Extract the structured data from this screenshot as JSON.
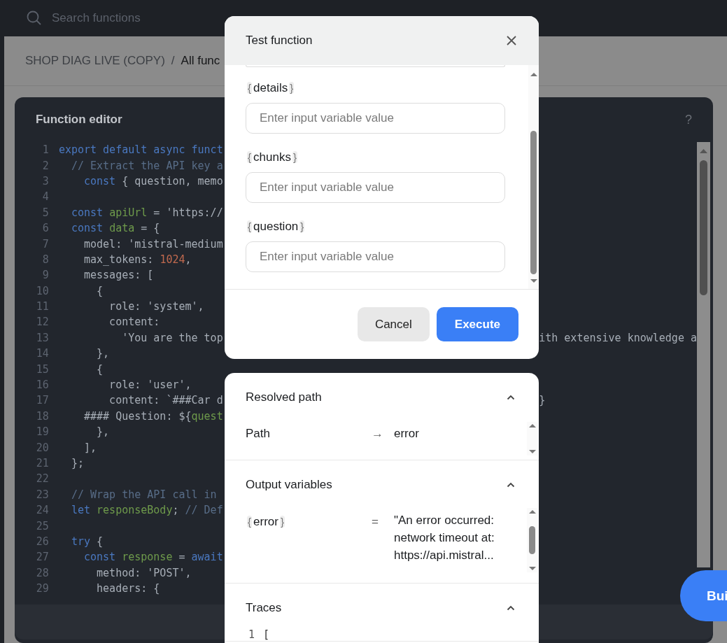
{
  "search": {
    "placeholder": "Search functions"
  },
  "breadcrumb": [
    {
      "label": "SHOP DIAG LIVE (COPY)",
      "current": false
    },
    {
      "label": "All func",
      "current": true
    }
  ],
  "breadcrumb_separator": "/",
  "editor": {
    "title": "Function editor",
    "help": "?",
    "lines": [
      {
        "n": "1",
        "tokens": [
          {
            "kind": "kw",
            "text": "export default async funct"
          }
        ]
      },
      {
        "n": "2",
        "tokens": [
          {
            "kind": "cm",
            "text": "  // Extract the API key a"
          }
        ]
      },
      {
        "n": "3",
        "tokens": [
          {
            "kind": "kw",
            "text": "    const"
          },
          {
            "kind": "p",
            "text": " { question, memo"
          }
        ]
      },
      {
        "n": "4"
      },
      {
        "n": "5",
        "tokens": [
          {
            "kind": "kw",
            "text": "  const "
          },
          {
            "kind": "id",
            "text": "apiUrl"
          },
          {
            "kind": "p",
            "text": " = "
          },
          {
            "kind": "str",
            "text": "'https://"
          }
        ]
      },
      {
        "n": "6",
        "tokens": [
          {
            "kind": "kw",
            "text": "  const "
          },
          {
            "kind": "id",
            "text": "data"
          },
          {
            "kind": "p",
            "text": " = {"
          }
        ]
      },
      {
        "n": "7",
        "tokens": [
          {
            "kind": "p",
            "text": "    model: "
          },
          {
            "kind": "str",
            "text": "'mistral-medium"
          }
        ]
      },
      {
        "n": "8",
        "tokens": [
          {
            "kind": "p",
            "text": "    max_tokens: "
          },
          {
            "kind": "num",
            "text": "1024"
          },
          {
            "kind": "p",
            "text": ","
          }
        ]
      },
      {
        "n": "9",
        "tokens": [
          {
            "kind": "p",
            "text": "    messages: ["
          }
        ]
      },
      {
        "n": "10",
        "tokens": [
          {
            "kind": "p",
            "text": "      {"
          }
        ]
      },
      {
        "n": "11",
        "tokens": [
          {
            "kind": "p",
            "text": "        role: "
          },
          {
            "kind": "str",
            "text": "'system'"
          },
          {
            "kind": "p",
            "text": ","
          }
        ]
      },
      {
        "n": "12",
        "tokens": [
          {
            "kind": "p",
            "text": "        content:"
          }
        ]
      },
      {
        "n": "13",
        "tokens": [
          {
            "kind": "str",
            "text": "          'You are the top"
          }
        ],
        "tail": "ith extensive knowledge a"
      },
      {
        "n": "14",
        "tokens": [
          {
            "kind": "p",
            "text": "      },"
          }
        ]
      },
      {
        "n": "15",
        "tokens": [
          {
            "kind": "p",
            "text": "      {"
          }
        ]
      },
      {
        "n": "16",
        "tokens": [
          {
            "kind": "p",
            "text": "        role: "
          },
          {
            "kind": "str",
            "text": "'user'"
          },
          {
            "kind": "p",
            "text": ","
          }
        ]
      },
      {
        "n": "17",
        "tokens": [
          {
            "kind": "p",
            "text": "        content: "
          },
          {
            "kind": "str",
            "text": "`###Car d"
          }
        ],
        "tail": "}"
      },
      {
        "n": "18",
        "tokens": [
          {
            "kind": "str",
            "text": "    #### Question: ${"
          },
          {
            "kind": "id",
            "text": "quest"
          }
        ]
      },
      {
        "n": "19",
        "tokens": [
          {
            "kind": "p",
            "text": "      },"
          }
        ]
      },
      {
        "n": "20",
        "tokens": [
          {
            "kind": "p",
            "text": "    ],"
          }
        ]
      },
      {
        "n": "21",
        "tokens": [
          {
            "kind": "p",
            "text": "  };"
          }
        ]
      },
      {
        "n": "22"
      },
      {
        "n": "23",
        "tokens": [
          {
            "kind": "cm",
            "text": "  // Wrap the API call in "
          }
        ]
      },
      {
        "n": "24",
        "tokens": [
          {
            "kind": "kw",
            "text": "  let "
          },
          {
            "kind": "id",
            "text": "responseBody"
          },
          {
            "kind": "p",
            "text": "; "
          },
          {
            "kind": "cm",
            "text": "// Def"
          }
        ]
      },
      {
        "n": "25"
      },
      {
        "n": "26",
        "tokens": [
          {
            "kind": "kw",
            "text": "  try"
          },
          {
            "kind": "p",
            "text": " {"
          }
        ]
      },
      {
        "n": "27",
        "tokens": [
          {
            "kind": "kw",
            "text": "    const "
          },
          {
            "kind": "id",
            "text": "response"
          },
          {
            "kind": "p",
            "text": " = "
          },
          {
            "kind": "kw",
            "text": "await"
          }
        ]
      },
      {
        "n": "28",
        "tokens": [
          {
            "kind": "p",
            "text": "      method: "
          },
          {
            "kind": "str",
            "text": "'POST'"
          },
          {
            "kind": "p",
            "text": ","
          }
        ]
      },
      {
        "n": "29",
        "tokens": [
          {
            "kind": "p",
            "text": "      headers: {"
          }
        ]
      }
    ]
  },
  "build_button": "Bui",
  "test_dialog": {
    "title": "Test function",
    "fields": [
      {
        "label": "{details}",
        "placeholder": "Enter input variable value"
      },
      {
        "label": "{chunks}",
        "placeholder": "Enter input variable value"
      },
      {
        "label": "{question}",
        "placeholder": "Enter input variable value"
      }
    ],
    "buttons": [
      {
        "label": "Cancel",
        "primary": false
      },
      {
        "label": "Execute",
        "primary": true
      }
    ]
  },
  "result_panel": {
    "sections": [
      {
        "kind": "path",
        "title": "Resolved path",
        "expanded": true,
        "name": "Path",
        "arrow": "→",
        "value": "error"
      },
      {
        "kind": "variables",
        "title": "Output variables",
        "expanded": true,
        "name": "{error}",
        "sign": "=",
        "value": "\"An error occurred: network timeout at: https://api.mistral..."
      },
      {
        "kind": "code",
        "title": "Traces",
        "expanded": true,
        "lines": [
          {
            "n": "1",
            "text": "["
          }
        ]
      }
    ]
  }
}
